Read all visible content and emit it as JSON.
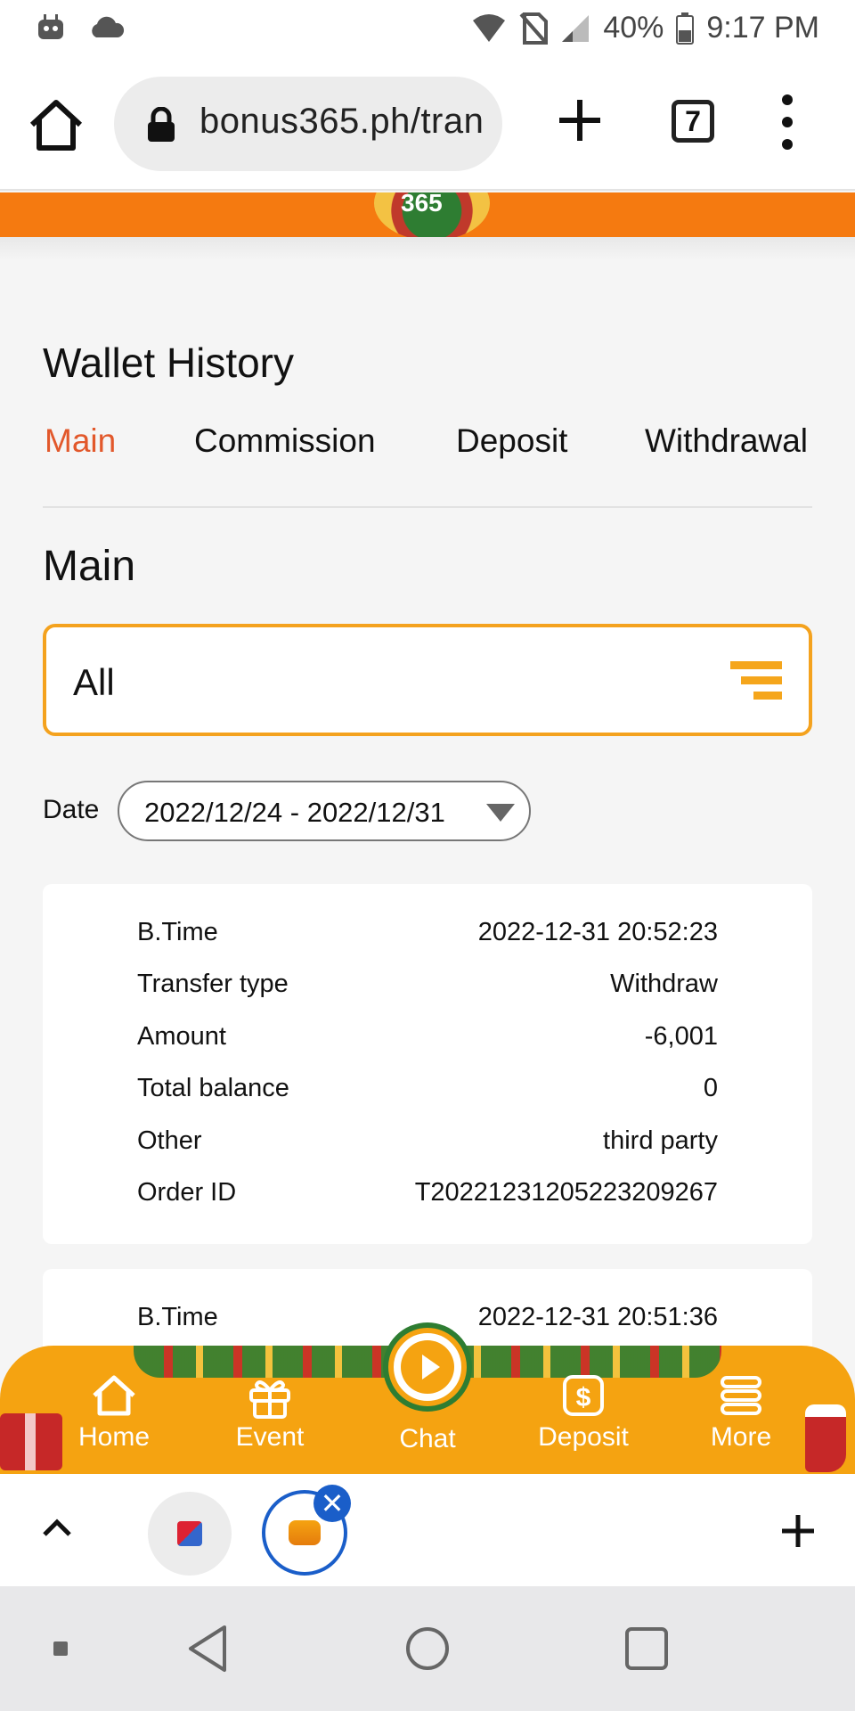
{
  "status_bar": {
    "battery": "40%",
    "time": "9:17 PM"
  },
  "browser": {
    "url": "bonus365.ph/tran",
    "tab_count": "7"
  },
  "banner": {
    "logo_text": "365"
  },
  "page": {
    "title": "Wallet History",
    "tabs": [
      "Main",
      "Commission",
      "Deposit",
      "Withdrawal"
    ],
    "active_tab": "Main",
    "section_title": "Main",
    "filter_value": "All",
    "date_label": "Date",
    "date_range": "2022/12/24 - 2022/12/31"
  },
  "records": [
    {
      "rows": [
        {
          "key": "B.Time",
          "value": "2022-12-31 20:52:23"
        },
        {
          "key": "Transfer type",
          "value": "Withdraw"
        },
        {
          "key": "Amount",
          "value": "-6,001"
        },
        {
          "key": "Total balance",
          "value": "0"
        },
        {
          "key": "Other",
          "value": "third party"
        },
        {
          "key": "Order ID",
          "value": "T20221231205223209267"
        }
      ]
    },
    {
      "rows": [
        {
          "key": "B.Time",
          "value": "2022-12-31 20:51:36"
        }
      ]
    }
  ],
  "bottom_nav": {
    "items": [
      "Home",
      "Event",
      "Chat",
      "Deposit",
      "More"
    ]
  },
  "colors": {
    "accent_orange": "#f5a311",
    "banner_orange": "#f57a10",
    "active_tab": "#e2582b",
    "tab_blue": "#1a5ec9"
  }
}
